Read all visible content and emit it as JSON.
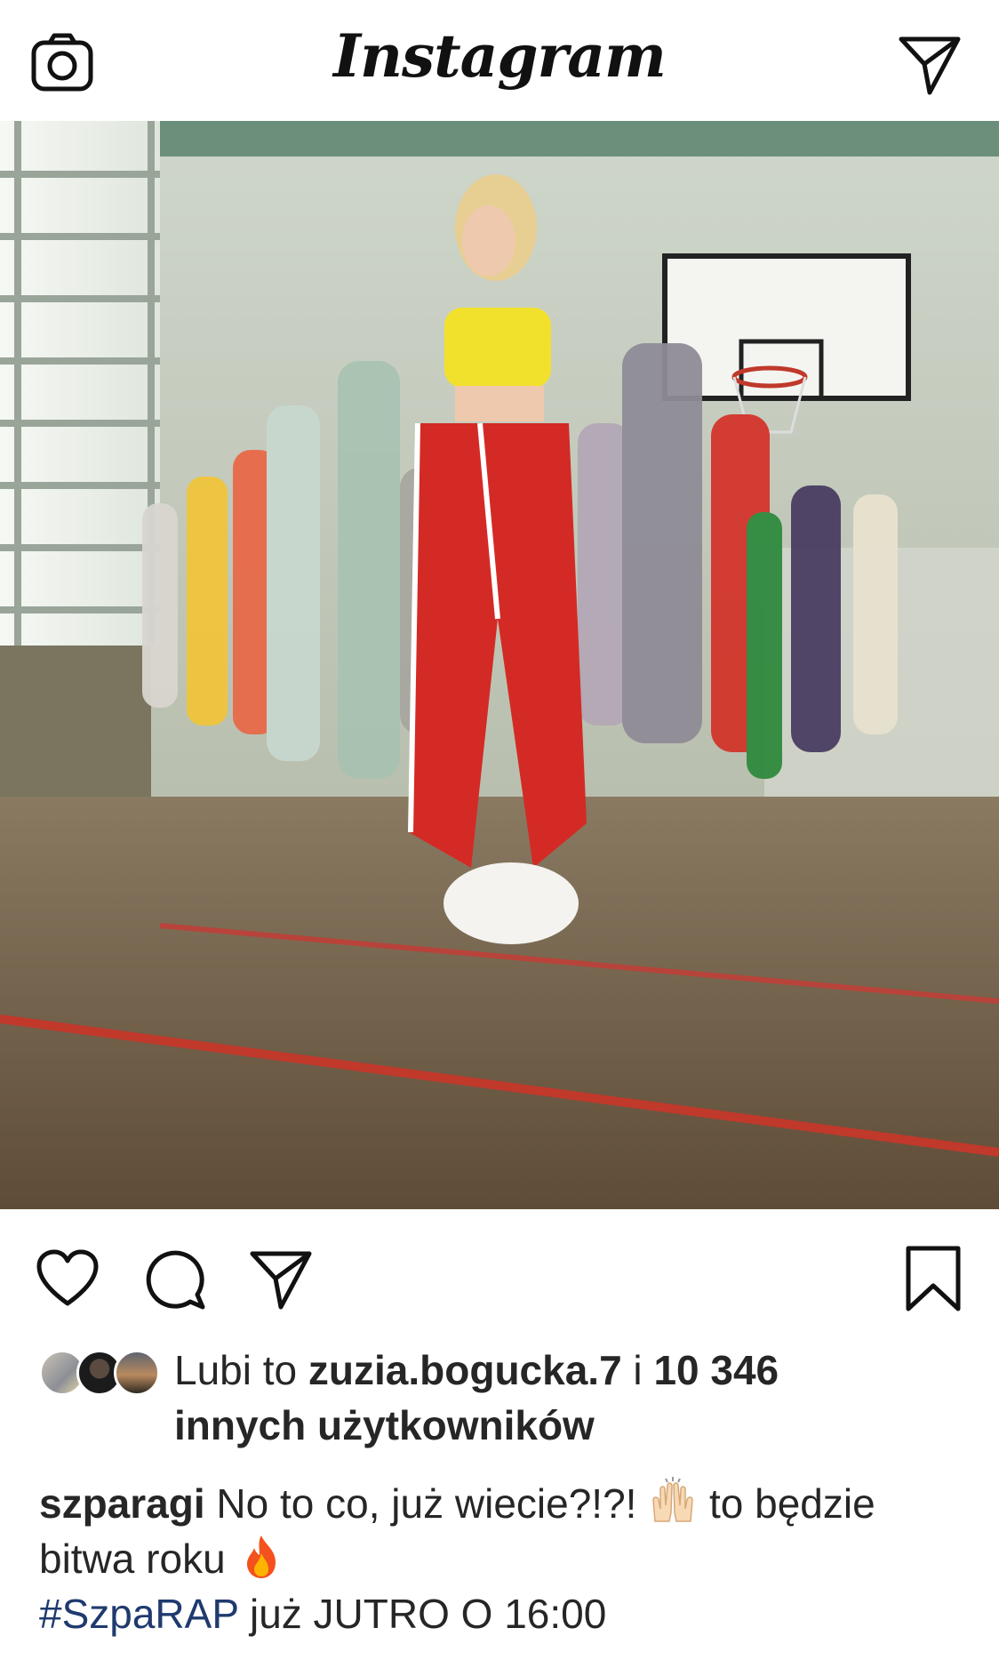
{
  "header": {
    "logo_text": "Instagram",
    "camera_icon": "camera-icon",
    "direct_icon": "paper-plane-icon"
  },
  "post": {
    "photo_icon": "post-photo",
    "actions": {
      "like_icon": "heart-icon",
      "comment_icon": "comment-bubble-icon",
      "share_icon": "paper-plane-icon",
      "save_icon": "bookmark-icon"
    },
    "likes": {
      "prefix": "Lubi to ",
      "user": "zuzia.bogucka.7",
      "connector": " i ",
      "count": "10 346",
      "suffix": "innych użytkowników"
    },
    "caption": {
      "username": "szparagi",
      "text1": " No to co, już wiecie?!?! ",
      "text2": " to będzie bitwa roku ",
      "hashtag": "#SzpaRAP",
      "text3": " już JUTRO  O 16:00"
    }
  },
  "colors": {
    "text": "#262626",
    "hashtag": "#1f3a6e",
    "background": "#ffffff"
  }
}
